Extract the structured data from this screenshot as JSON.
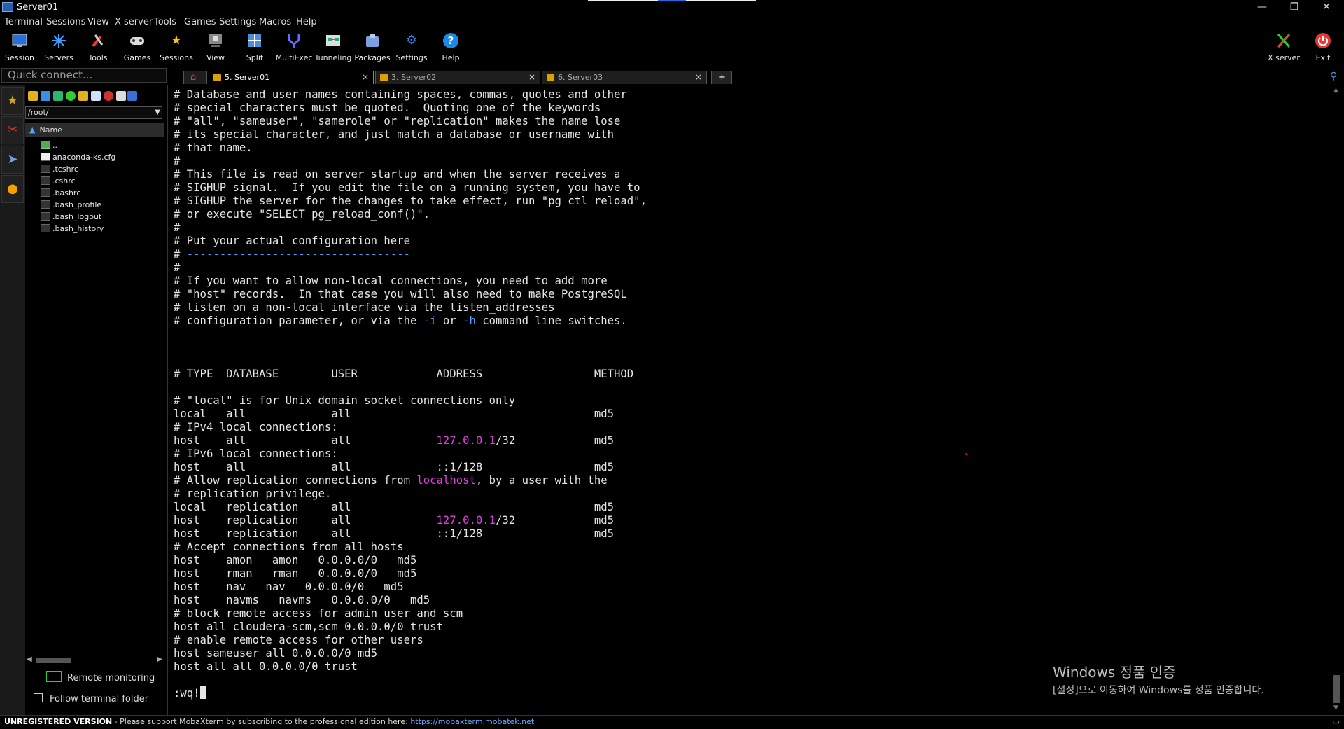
{
  "window": {
    "title": "Server01",
    "min_label": "—",
    "restore_label": "❐",
    "close_label": "✕"
  },
  "menu": [
    "Terminal",
    "Sessions",
    "View",
    "X server",
    "Tools",
    "Games",
    "Settings",
    "Macros",
    "Help"
  ],
  "toolbar": {
    "items": [
      {
        "label": "Session",
        "icon": "session-icon"
      },
      {
        "label": "Servers",
        "icon": "servers-icon"
      },
      {
        "label": "Tools",
        "icon": "tools-icon"
      },
      {
        "label": "Games",
        "icon": "games-icon"
      },
      {
        "label": "Sessions",
        "icon": "sessions-star-icon"
      },
      {
        "label": "View",
        "icon": "view-icon"
      },
      {
        "label": "Split",
        "icon": "split-icon"
      },
      {
        "label": "MultiExec",
        "icon": "multiexec-icon"
      },
      {
        "label": "Tunneling",
        "icon": "tunneling-icon"
      },
      {
        "label": "Packages",
        "icon": "packages-icon"
      },
      {
        "label": "Settings",
        "icon": "settings-icon"
      },
      {
        "label": "Help",
        "icon": "help-icon"
      }
    ],
    "xserver_label": "X server",
    "exit_label": "Exit"
  },
  "quick_connect": {
    "placeholder": "Quick connect..."
  },
  "tabs": [
    {
      "label": "5. Server01",
      "active": true,
      "close": "×"
    },
    {
      "label": "3. Server02",
      "active": false,
      "close": "×"
    },
    {
      "label": "6. Server03",
      "active": false,
      "close": "×"
    }
  ],
  "sftp": {
    "path": "/root/",
    "column_name": "Name",
    "files": [
      "..",
      "anaconda-ks.cfg",
      ".tcshrc",
      ".cshrc",
      ".bashrc",
      ".bash_profile",
      ".bash_logout",
      ".bash_history"
    ],
    "remote_monitoring": "Remote monitoring",
    "follow_terminal": "Follow terminal folder"
  },
  "terminal": {
    "lines": [
      "# Database and user names containing spaces, commas, quotes and other",
      "# special characters must be quoted.  Quoting one of the keywords",
      "# \"all\", \"sameuser\", \"samerole\" or \"replication\" makes the name lose",
      "# its special character, and just match a database or username with",
      "# that name.",
      "#",
      "# This file is read on server startup and when the server receives a",
      "# SIGHUP signal.  If you edit the file on a running system, you have to",
      "# SIGHUP the server for the changes to take effect, run \"pg_ctl reload\",",
      "# or execute \"SELECT pg_reload_conf()\".",
      "#",
      "# Put your actual configuration here",
      "# ----------------------------------",
      "#",
      "# If you want to allow non-local connections, you need to add more",
      "# \"host\" records.  In that case you will also need to make PostgreSQL",
      "# listen on a non-local interface via the listen_addresses",
      "# configuration parameter, or via the -i or -h command line switches.",
      "",
      "",
      "",
      "# TYPE  DATABASE        USER            ADDRESS                 METHOD",
      "",
      "# \"local\" is for Unix domain socket connections only",
      "local   all             all                                     md5",
      "# IPv4 local connections:",
      "host    all             all             127.0.0.1/32            md5",
      "# IPv6 local connections:",
      "host    all             all             ::1/128                 md5",
      "# Allow replication connections from localhost, by a user with the",
      "# replication privilege.",
      "local   replication     all                                     md5",
      "host    replication     all             127.0.0.1/32            md5",
      "host    replication     all             ::1/128                 md5",
      "# Accept connections from all hosts",
      "host    amon   amon   0.0.0.0/0   md5",
      "host    rman   rman   0.0.0.0/0   md5",
      "host    nav   nav   0.0.0.0/0   md5",
      "host    navms   navms   0.0.0.0/0   md5",
      "# block remote access for admin user and scm",
      "host all cloudera-scm,scm 0.0.0.0/0 trust",
      "# enable remote access for other users",
      "host sameuser all 0.0.0.0/0 md5",
      "host all all 0.0.0.0/0 trust"
    ],
    "command": ":wq!"
  },
  "activation": {
    "line1": "Windows 정품 인증",
    "line2": "[설정]으로 이동하여 Windows를 정품 인증합니다."
  },
  "status": {
    "unregistered": "UNREGISTERED VERSION",
    "message": " -  Please support MobaXterm by subscribing to the professional edition here:  ",
    "link": "https://mobaxterm.mobatek.net"
  },
  "colors": {
    "accent_blue": "#4aa3ff",
    "accent_magenta": "#e040e0",
    "background": "#000000"
  }
}
